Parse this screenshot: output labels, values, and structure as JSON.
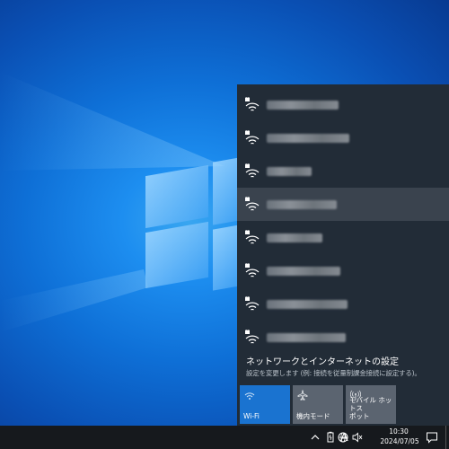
{
  "network_flyout": {
    "networks": [
      {
        "ssid_visible": false,
        "secured": true
      },
      {
        "ssid_visible": false,
        "secured": true
      },
      {
        "ssid_visible": false,
        "secured": true
      },
      {
        "ssid_visible": false,
        "secured": true,
        "hovered": true
      },
      {
        "ssid_visible": false,
        "secured": true
      },
      {
        "ssid_visible": false,
        "secured": true
      },
      {
        "ssid_visible": false,
        "secured": true
      },
      {
        "ssid_visible": false,
        "secured": true
      }
    ],
    "settings_link": "ネットワークとインターネットの設定",
    "settings_subtext": "設定を変更します (例: 接続を従量制課金接続に設定する)。",
    "quick_actions": {
      "wifi": {
        "label": "Wi-Fi",
        "active": true
      },
      "airplane": {
        "label": "機内モード",
        "active": false
      },
      "hotspot": {
        "label_line1": "モバイル ホットス",
        "label_line2": "ポット",
        "active": false
      }
    }
  },
  "taskbar": {
    "ime_indicator": "A",
    "time": "10:30",
    "date": "2024/07/05",
    "tray_icons": [
      "chevron-up-icon",
      "battery-icon",
      "globe-icon",
      "volume-muted-icon"
    ]
  },
  "colors": {
    "flyout_bg": "#222c37",
    "accent": "#1a73d0",
    "taskbar_bg": "#16191d"
  }
}
